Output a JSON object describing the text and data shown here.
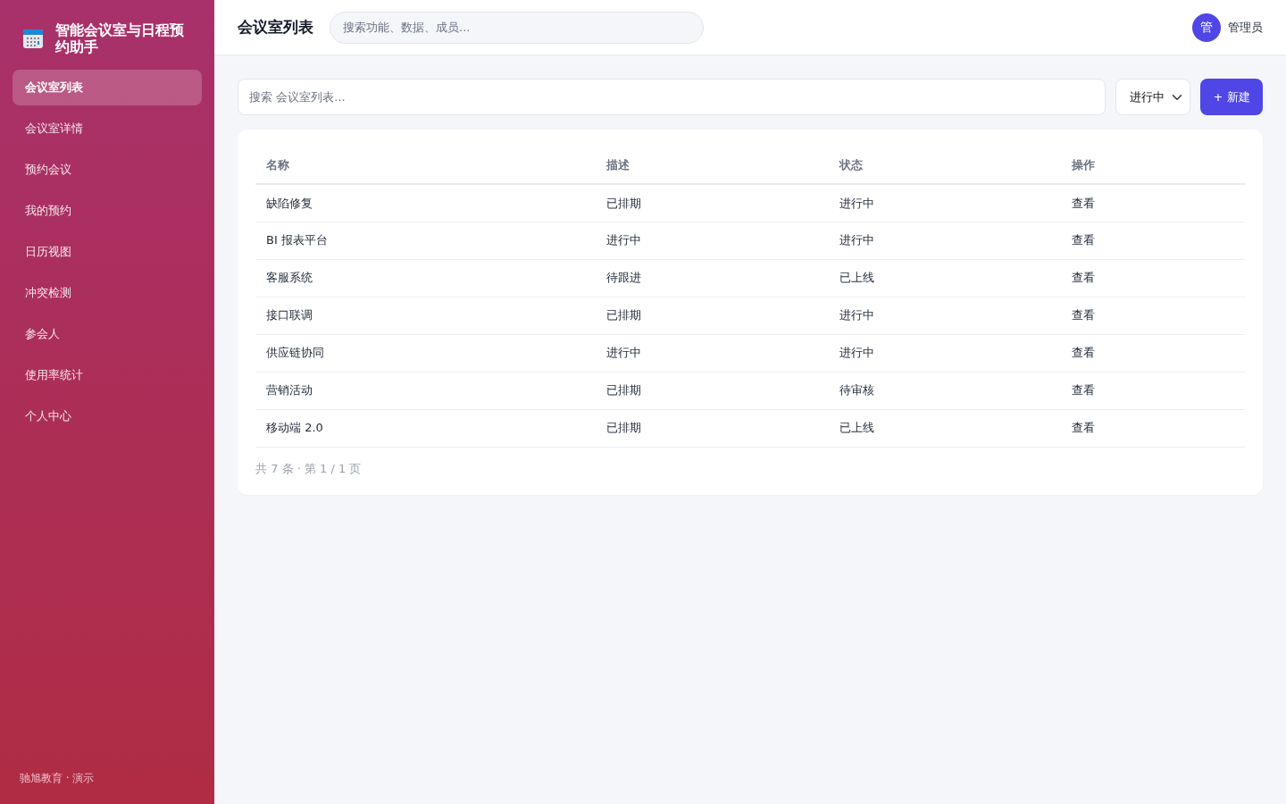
{
  "sidebar": {
    "brand": "智能会议室与日程预约助手",
    "items": [
      {
        "label": "会议室列表",
        "selected": true
      },
      {
        "label": "会议室详情",
        "selected": false
      },
      {
        "label": "预约会议",
        "selected": false
      },
      {
        "label": "我的预约",
        "selected": false
      },
      {
        "label": "日历视图",
        "selected": false
      },
      {
        "label": "冲突检测",
        "selected": false
      },
      {
        "label": "参会人",
        "selected": false
      },
      {
        "label": "使用率统计",
        "selected": false
      },
      {
        "label": "个人中心",
        "selected": false
      }
    ],
    "footer": "驰旭教育 · 演示"
  },
  "topbar": {
    "title": "会议室列表",
    "search": {
      "placeholder": "搜索功能、数据、成员..."
    },
    "user": {
      "avatar": "管",
      "name": "管理员"
    }
  },
  "toolbar": {
    "search": {
      "placeholder": "搜索 会议室列表..."
    },
    "filter": {
      "value": "进行中"
    },
    "new_button": "+ 新建"
  },
  "table": {
    "columns": [
      "名称",
      "描述",
      "状态",
      "操作"
    ],
    "rows": [
      [
        "缺陷修复",
        "已排期",
        "进行中",
        "查看"
      ],
      [
        "BI 报表平台",
        "进行中",
        "进行中",
        "查看"
      ],
      [
        "客服系统",
        "待跟进",
        "已上线",
        "查看"
      ],
      [
        "接口联调",
        "已排期",
        "进行中",
        "查看"
      ],
      [
        "供应链协同",
        "进行中",
        "进行中",
        "查看"
      ],
      [
        "营销活动",
        "已排期",
        "待审核",
        "查看"
      ],
      [
        "移动端 2.0",
        "已排期",
        "已上线",
        "查看"
      ]
    ]
  },
  "pagination": "共 7 条 · 第 1 / 1 页"
}
